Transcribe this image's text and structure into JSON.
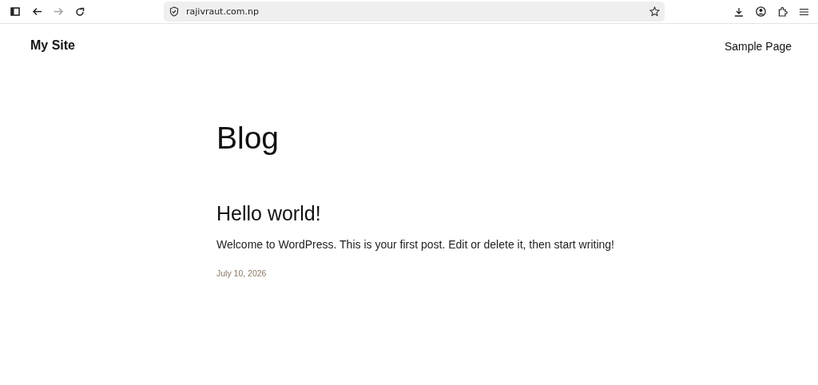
{
  "browser": {
    "nav_buttons": [
      {
        "kind": "sidebar",
        "disabled": false
      },
      {
        "kind": "back",
        "disabled": false
      },
      {
        "kind": "forward",
        "disabled": true
      },
      {
        "kind": "reload",
        "disabled": false
      }
    ],
    "url": "rajivraut.com.np"
  },
  "site": {
    "title": "My Site",
    "nav": [
      "Sample Page"
    ]
  },
  "page": {
    "heading": "Blog",
    "posts": [
      {
        "title": "Hello world!",
        "excerpt": "Welcome to WordPress. This is your first post. Edit or delete it, then start writing!",
        "date": "July 10, 2026"
      }
    ]
  }
}
